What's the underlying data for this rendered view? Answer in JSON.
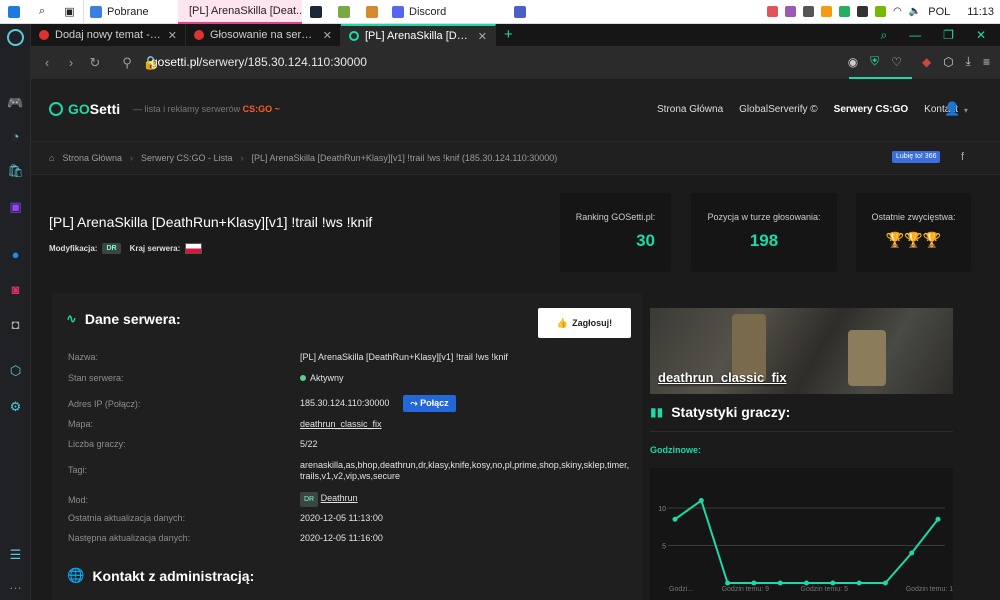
{
  "taskbar": {
    "pinned": [
      "windows-logo",
      "search-icon",
      "task-view-icon"
    ],
    "windows": [
      {
        "label": "Pobrane",
        "color": "#3d7fe0",
        "active": false
      },
      {
        "label": "[PL] ArenaSkilla [Deat...",
        "color": "#e0568a",
        "active": true
      },
      {
        "label": "",
        "color": "#1b2838",
        "active": false
      },
      {
        "label": "",
        "color": "#7aa843",
        "active": false
      },
      {
        "label": "",
        "color": "#d48a2f",
        "active": false
      },
      {
        "label": "Discord",
        "color": "#5865f2",
        "active": false
      },
      {
        "label": "",
        "color": "#4b5fc9",
        "active": false
      }
    ],
    "language": "POL",
    "time": "11:13"
  },
  "browser": {
    "tabs": [
      {
        "title": "Dodaj nowy temat - ArenaSk",
        "active": false
      },
      {
        "title": "Głosowanie na serwery CS:GO",
        "active": false
      },
      {
        "title": "[PL] ArenaSkilla [DeathRun+",
        "active": true
      }
    ],
    "url_host": "gosetti.pl",
    "url_path": "/serwery/185.30.124.110:30000"
  },
  "site": {
    "logo_go": "GO",
    "logo_rest": "Setti",
    "tagline": "— lista i reklamy serwerów",
    "tagline_game": "CS:GO ~",
    "menu": [
      "Strona Główna",
      "GlobalServerify ©",
      "Serwery CS:GO",
      "Kontakt"
    ],
    "menu_current": "Serwery CS:GO"
  },
  "breadcrumb": [
    "Strona Główna",
    "Serwery CS:GO - Lista",
    "[PL] ArenaSkilla [DeathRun+Klasy][v1] !trail !ws !knif (185.30.124.110:30000)"
  ],
  "fb_like": "Lubię to! 366",
  "server": {
    "title": "[PL] ArenaSkilla [DeathRun+Klasy][v1] !trail !ws !knif",
    "mod_label": "Modyfikacja:",
    "mod_badge": "DR",
    "country_label": "Kraj serwera:"
  },
  "stats_boxes": [
    {
      "label": "Ranking GOSetti.pl:",
      "value": "30"
    },
    {
      "label": "Pozycja w turze głosowania:",
      "value": "198"
    },
    {
      "label": "Ostatnie zwycięstwa:",
      "value": "🏆🏆🏆"
    }
  ],
  "details": {
    "heading": "Dane serwera:",
    "vote_button": "Zagłosuj!",
    "rows": [
      {
        "key": "Nazwa:",
        "value": "[PL] ArenaSkilla [DeathRun+Klasy][v1] !trail !ws !knif"
      },
      {
        "key": "Stan serwera:",
        "value": "Aktywny"
      },
      {
        "key": "Adres IP (Połącz):",
        "value": "185.30.124.110:30000",
        "button": "Połącz"
      },
      {
        "key": "Mapa:",
        "value": "deathrun_classic_fix"
      },
      {
        "key": "Liczba graczy:",
        "value": "5/22"
      },
      {
        "key": "Tagi:",
        "value": "arenaskilla,as,bhop,deathrun,dr,klasy,knife,kosy,no,pl,prime,shop,skiny,sklep,timer,trails,v1,v2,vip,ws,secure"
      },
      {
        "key": "Mod:",
        "value": "Deathrun",
        "badge": "DR"
      },
      {
        "key": "Ostatnia aktualizacja danych:",
        "value": "2020-12-05 11:13:00"
      },
      {
        "key": "Następna aktualizacja danych:",
        "value": "2020-12-05 11:16:00"
      }
    ]
  },
  "contact_heading": "Kontakt z administracją:",
  "map_name": "deathrun_classic_fix",
  "stats_heading": "Statystyki graczy:",
  "hourly_label": "Godzinowe:",
  "chart_data": {
    "type": "line",
    "title": "",
    "x": [
      "Godz...",
      "",
      "Godzin temu: 9",
      "",
      "",
      "Godzin temu: 5",
      "",
      "",
      "",
      "Godzin temu: 1",
      ""
    ],
    "tick_labels": [
      "Godzi...",
      "Godzin temu: 9",
      "Godzin temu: 5",
      "Godzin temu: 1"
    ],
    "series": [
      {
        "values": [
          8.5,
          11,
          0,
          0,
          0,
          0,
          0,
          0,
          0,
          4,
          8.5
        ],
        "color": "#1ed8a6"
      }
    ],
    "yticks": [
      5,
      10
    ],
    "ylim": [
      0,
      14
    ],
    "grid": true
  }
}
